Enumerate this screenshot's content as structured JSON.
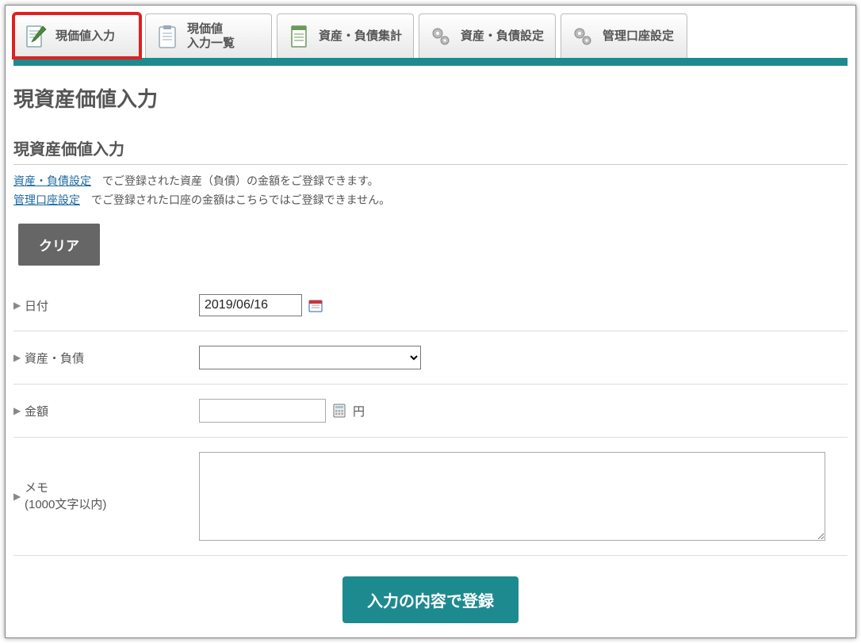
{
  "tabs": [
    {
      "label": "現価値入力"
    },
    {
      "label": "現価値\n入力一覧"
    },
    {
      "label": "資産・負債集計"
    },
    {
      "label": "資産・負債設定"
    },
    {
      "label": "管理口座設定"
    }
  ],
  "page_title": "現資産価値入力",
  "section_title": "現資産価値入力",
  "hints": {
    "link1": "資産・負債設定",
    "text1": "　でご登録された資産（負債）の金額をご登録できます。",
    "link2": "管理口座設定",
    "text2": "　でご登録された口座の金額はこちらではご登録できません。"
  },
  "buttons": {
    "clear": "クリア",
    "submit": "入力の内容で登録"
  },
  "form": {
    "date_label": "日付",
    "date_value": "2019/06/16",
    "asset_label": "資産・負債",
    "amount_label": "金額",
    "amount_unit": "円",
    "memo_label_line1": "メモ",
    "memo_label_line2": "(1000文字以内)"
  }
}
